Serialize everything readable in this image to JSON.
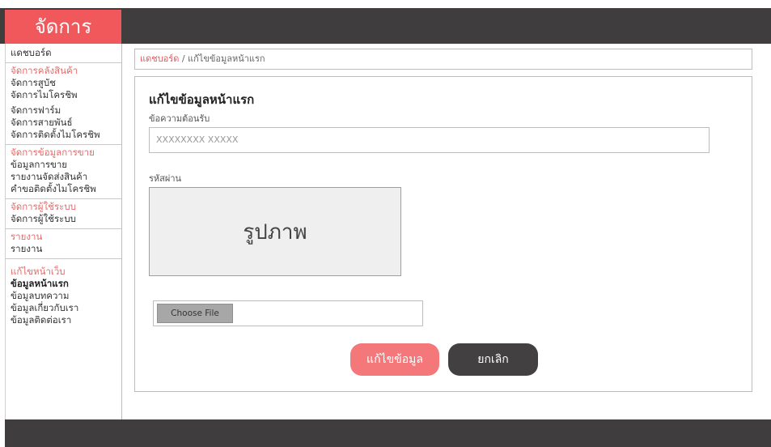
{
  "brand": {
    "title": "จัดการ"
  },
  "sidebar": {
    "groups": [
      {
        "items": [
          "แดชบอร์ด"
        ]
      },
      {
        "header": "จัดการคลังสินค้า",
        "items": [
          "จัดการสูบัช",
          "จัดการไมโครชิพ",
          "จัดการฟาร์ม",
          "จัดการสายพันธ์",
          "จัดการติดตั้งไมโครชิพ"
        ]
      },
      {
        "header": "จัดการข้อมูลการขาย",
        "items": [
          "ข้อมูลการขาย",
          "รายงานจัดส่งสินค้า",
          "คำขอติดตั้งไมโครชิพ"
        ]
      },
      {
        "header": "จัดการผู้ใช้ระบบ",
        "items": [
          "จัดการผู้ใช้ระบบ"
        ]
      },
      {
        "header": "รายงาน",
        "items": [
          "รายงาน"
        ]
      },
      {
        "header": "แก้ไขหน้าเว็บ",
        "items": [
          "ข้อมูลหน้าแรก",
          "ข้อมูลบทความ",
          "ข้อมูลเกี่ยวกับเรา",
          "ข้อมูลติดต่อเรา"
        ]
      }
    ]
  },
  "breadcrumb": {
    "home": "แดชบอร์ด",
    "separator": " / ",
    "current": "แก้ไขข้อมูลหน้าแรก"
  },
  "form": {
    "title": "แก้ไขข้อมูลหน้าแรก",
    "welcome_label": "ข้อความต้อนรับ",
    "welcome_value": "XXXXXXXX XXXXX",
    "image_label": "รหัสผ่าน",
    "image_placeholder": "รูปภาพ",
    "choose_file": "Choose File",
    "save_label": "แก้ไขข้อมูล",
    "cancel_label": "ยกเลิก"
  },
  "colors": {
    "accent": "#f0585c",
    "dark": "#3f3d3d",
    "save": "#f4787a",
    "cancel": "#424040"
  }
}
